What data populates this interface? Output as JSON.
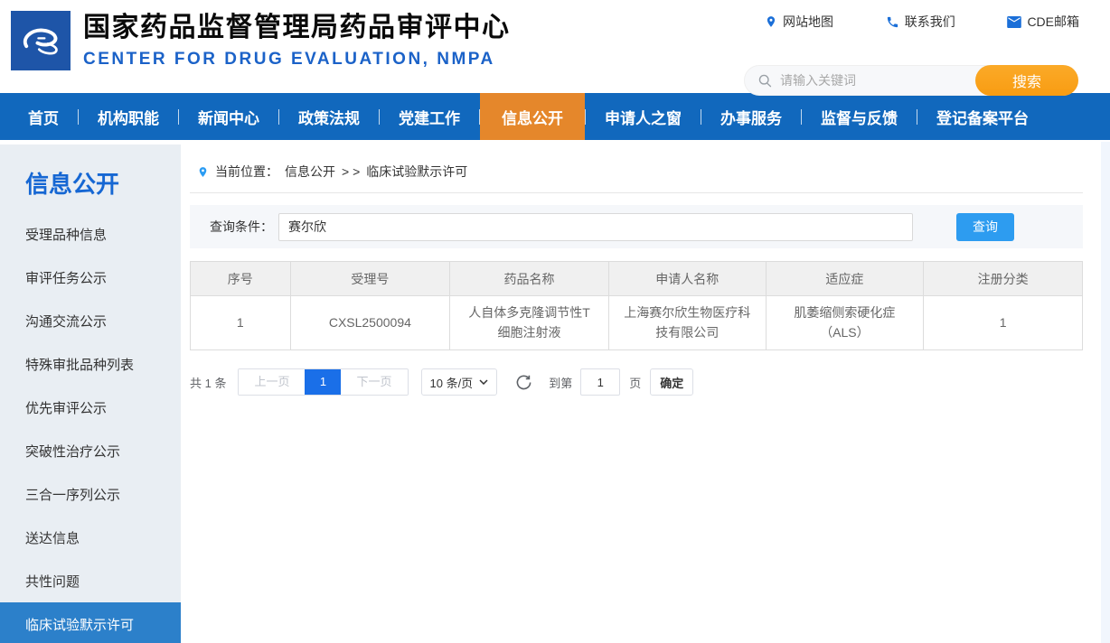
{
  "header": {
    "title_cn": "国家药品监督管理局药品审评中心",
    "title_en": "CENTER FOR DRUG EVALUATION, NMPA",
    "links": [
      {
        "label": "网站地图",
        "icon": "map-pin-icon"
      },
      {
        "label": "联系我们",
        "icon": "phone-icon"
      },
      {
        "label": "CDE邮箱",
        "icon": "mail-icon"
      }
    ],
    "search": {
      "placeholder": "请输入关键词",
      "button": "搜索"
    }
  },
  "nav": {
    "items": [
      "首页",
      "机构职能",
      "新闻中心",
      "政策法规",
      "党建工作",
      "信息公开",
      "申请人之窗",
      "办事服务",
      "监督与反馈",
      "登记备案平台"
    ],
    "active": "信息公开"
  },
  "sidebar": {
    "title": "信息公开",
    "items": [
      "受理品种信息",
      "审评任务公示",
      "沟通交流公示",
      "特殊审批品种列表",
      "优先审评公示",
      "突破性治疗公示",
      "三合一序列公示",
      "送达信息",
      "共性问题",
      "临床试验默示许可"
    ],
    "active": "临床试验默示许可"
  },
  "breadcrumb": {
    "prefix": "当前位置：",
    "section": "信息公开",
    "separator": ">  >",
    "current": "临床试验默示许可"
  },
  "query": {
    "label": "查询条件：",
    "value": "赛尔欣",
    "button": "查询"
  },
  "table": {
    "headers": [
      "序号",
      "受理号",
      "药品名称",
      "申请人名称",
      "适应症",
      "注册分类"
    ],
    "rows": [
      [
        "1",
        "CXSL2500094",
        "人自体多克隆调节性T细胞注射液",
        "上海赛尔欣生物医疗科技有限公司",
        "肌萎缩侧索硬化症（ALS）",
        "1"
      ]
    ]
  },
  "pagination": {
    "total": "共 1 条",
    "prev": "上一页",
    "page": "1",
    "next": "下一页",
    "page_size": "10 条/页",
    "goto_label": "到第",
    "goto_value": "1",
    "goto_unit": "页",
    "confirm": "确定"
  },
  "colors": {
    "nav_blue": "#1168bd",
    "nav_active_orange": "#e5872b",
    "search_button_orange": "#f89c12",
    "link_icon_blue": "#1b6fd8",
    "title_en_blue": "#1b62c8",
    "sidebar_bg": "#e9eef3",
    "sidebar_active_blue": "#2c80ca",
    "query_button_blue": "#2d9cf0",
    "page_active_blue": "#1a6fe8",
    "logo_blue": "#1e55a8"
  }
}
